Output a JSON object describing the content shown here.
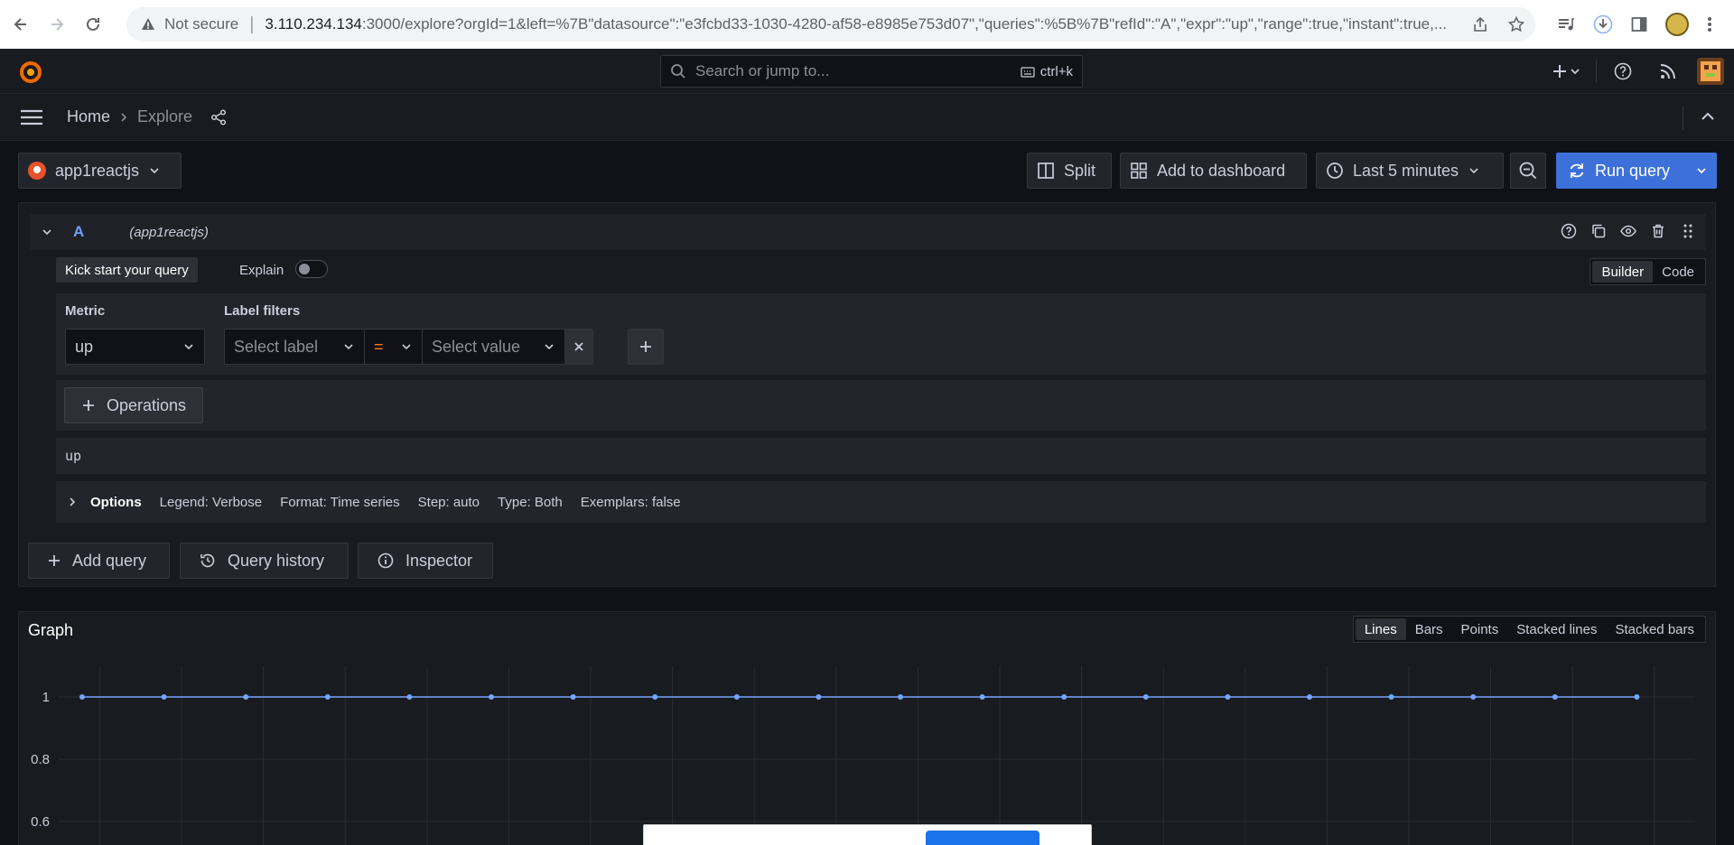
{
  "browser": {
    "not_secure": "Not secure",
    "url_host": "3.110.234.134",
    "url_path": ":3000/explore?orgId=1&left=%7B\"datasource\":\"e3fcbd33-1030-4280-af58-e8985e753d07\",\"queries\":%5B%7B\"refId\":\"A\",\"expr\":\"up\",\"range\":true,\"instant\":true,..."
  },
  "topbar": {
    "search_placeholder": "Search or jump to...",
    "search_shortcut": "ctrl+k"
  },
  "breadcrumb": {
    "home": "Home",
    "current": "Explore"
  },
  "toolbar": {
    "datasource": "app1reactjs",
    "split": "Split",
    "add_to_dashboard": "Add to dashboard",
    "time_range": "Last 5 minutes",
    "run_query": "Run query"
  },
  "query": {
    "ref_id": "A",
    "datasource_label": "(app1reactjs)",
    "kick_start": "Kick start your query",
    "explain": "Explain",
    "mode_builder": "Builder",
    "mode_code": "Code",
    "metric_label": "Metric",
    "metric_value": "up",
    "label_filters_label": "Label filters",
    "select_label": "Select label",
    "operator": "=",
    "select_value": "Select value",
    "operations": "Operations",
    "expression": "up",
    "options": {
      "title": "Options",
      "legend": "Legend: Verbose",
      "format": "Format: Time series",
      "step": "Step: auto",
      "type": "Type: Both",
      "exemplars": "Exemplars: false"
    }
  },
  "actions": {
    "add_query": "Add query",
    "query_history": "Query history",
    "inspector": "Inspector"
  },
  "graph": {
    "title": "Graph",
    "modes": [
      "Lines",
      "Bars",
      "Points",
      "Stacked lines",
      "Stacked bars"
    ],
    "active_mode": "Lines"
  },
  "chart_data": {
    "type": "line",
    "title": "Graph",
    "y_ticks": [
      "1",
      "0.8",
      "0.6"
    ],
    "series": [
      {
        "values": [
          1,
          1,
          1,
          1,
          1,
          1,
          1,
          1,
          1,
          1,
          1,
          1,
          1,
          1,
          1,
          1,
          1,
          1,
          1,
          1
        ]
      }
    ],
    "ylim": [
      0.6,
      1
    ],
    "grid": true,
    "line_color": "#73a6ff"
  },
  "colors": {
    "accent": "#3d71d9",
    "background": "#111217",
    "panel": "#181b1f"
  }
}
